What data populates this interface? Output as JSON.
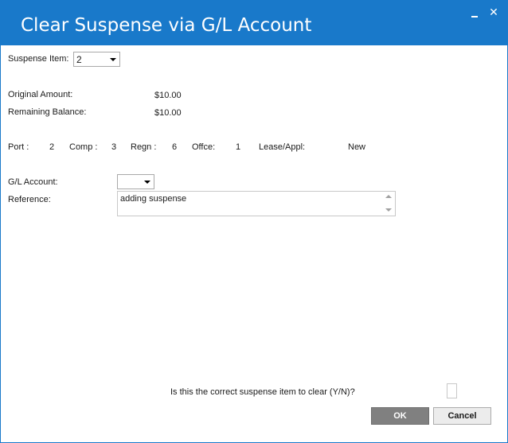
{
  "window": {
    "title": "Clear Suspense via G/L Account"
  },
  "suspense_item": {
    "label": "Suspense Item:",
    "value": "2"
  },
  "amounts": {
    "original_label": "Original Amount:",
    "original_value": "$10.00",
    "remaining_label": "Remaining Balance:",
    "remaining_value": "$10.00"
  },
  "location": {
    "port_label": "Port :",
    "port_value": "2",
    "comp_label": "Comp :",
    "comp_value": "3",
    "regn_label": "Regn :",
    "regn_value": "6",
    "offce_label": "Offce:",
    "offce_value": "1",
    "lease_label": "Lease/Appl:",
    "lease_value": "New"
  },
  "gl_account": {
    "label": "G/L Account:",
    "value": ""
  },
  "reference": {
    "label": "Reference:",
    "value": "adding suspense"
  },
  "confirm": {
    "question": "Is this the correct suspense item to clear (Y/N)?",
    "checked": false
  },
  "buttons": {
    "ok": "OK",
    "cancel": "Cancel"
  },
  "colors": {
    "titlebar": "#1979ca",
    "ok_button": "#808080"
  }
}
